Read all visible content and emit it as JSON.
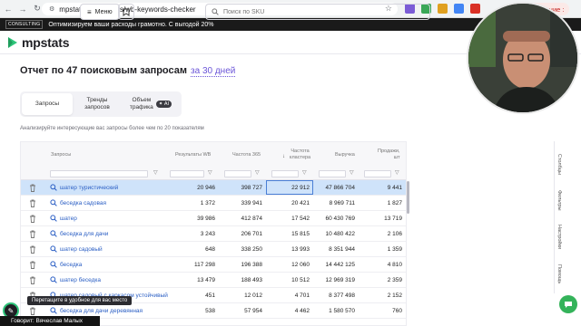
{
  "browser": {
    "url": "mpstats.io/seo/tools/wb-keywords-checker",
    "update_label": "Обновление :"
  },
  "promo": {
    "badge": "CONSULTING",
    "text": "Оптимизируем ваши расходы грамотно. С выгодой 20%"
  },
  "header": {
    "logo_text": "mpstats",
    "menu_label": "Меню",
    "search_placeholder": "Поиск по SKU"
  },
  "page": {
    "title": "Отчет по 47 поисковым запросам",
    "period": "за 30 дней",
    "hint": "Анализируйте интересующие вас запросы более чем по 20 показателям"
  },
  "tabs": [
    {
      "label": "Запросы"
    },
    {
      "label": "Тренды\nзапросов"
    },
    {
      "label": "Объем\nтрафика",
      "badge": "AI"
    }
  ],
  "table": {
    "columns": {
      "query": "Запросы",
      "results": "Результаты WB",
      "freq": "Частота 365",
      "cluster": "Частота\nкластера",
      "revenue": "Выручка",
      "sales": "Продажи,\nшт"
    },
    "rows": [
      {
        "query": "шатер туристический",
        "results": "20 946",
        "freq": "398 727",
        "cluster": "22 912",
        "revenue": "47 866 704",
        "sales": "9 441"
      },
      {
        "query": "беседка садовая",
        "results": "1 372",
        "freq": "339 941",
        "cluster": "20 421",
        "revenue": "8 969 711",
        "sales": "1 827"
      },
      {
        "query": "шатер",
        "results": "39 986",
        "freq": "412 874",
        "cluster": "17 542",
        "revenue": "60 430 769",
        "sales": "13 719"
      },
      {
        "query": "беседка для дачи",
        "results": "3 243",
        "freq": "206 701",
        "cluster": "15 815",
        "revenue": "10 480 422",
        "sales": "2 106"
      },
      {
        "query": "шатер садовый",
        "results": "648",
        "freq": "338 250",
        "cluster": "13 993",
        "revenue": "8 351 944",
        "sales": "1 359"
      },
      {
        "query": "беседка",
        "results": "117 298",
        "freq": "196 388",
        "cluster": "12 060",
        "revenue": "14 442 125",
        "sales": "4 810"
      },
      {
        "query": "шатер беседка",
        "results": "13 479",
        "freq": "188 493",
        "cluster": "10 512",
        "revenue": "12 969 319",
        "sales": "2 359"
      },
      {
        "query": "шатер садовый с каркасом устойчивый",
        "results": "451",
        "freq": "12 012",
        "cluster": "4 701",
        "revenue": "8 377 498",
        "sales": "2 152"
      },
      {
        "query": "беседка для дачи деревянная",
        "results": "538",
        "freq": "57 954",
        "cluster": "4 462",
        "revenue": "1 580 570",
        "sales": "760"
      }
    ]
  },
  "rail": [
    "Столбцы",
    "Фильтры",
    "Настройки",
    "Помощь"
  ],
  "overlays": {
    "tooltip": "Перетащите в удобное для вас место",
    "speaker": "Говорит: Вячеслав Малых"
  },
  "colors": {
    "accent": "#6b55d8",
    "link": "#2a5ec4",
    "selected_row": "#cfe3fa",
    "chat": "#34b35a"
  }
}
